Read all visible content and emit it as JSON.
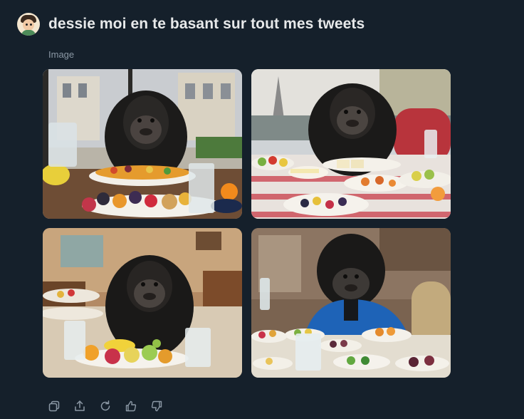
{
  "prompt": {
    "text": "dessie moi en te basant sur tout mes tweets"
  },
  "media": {
    "label": "Image",
    "images": [
      {
        "icon": "gorilla-dining-fruit-cafe-image"
      },
      {
        "icon": "gorilla-dining-paris-terrace-image"
      },
      {
        "icon": "gorilla-dining-restaurant-fruit-image"
      },
      {
        "icon": "gorilla-blue-jacket-dining-image"
      }
    ]
  },
  "actions": [
    {
      "icon": "copy-icon"
    },
    {
      "icon": "share-icon"
    },
    {
      "icon": "regenerate-icon"
    },
    {
      "icon": "thumbs-up-icon"
    },
    {
      "icon": "thumbs-down-icon"
    }
  ],
  "colors": {
    "background": "#15202b",
    "text": "#e7e9ea",
    "muted": "#8b98a5"
  }
}
